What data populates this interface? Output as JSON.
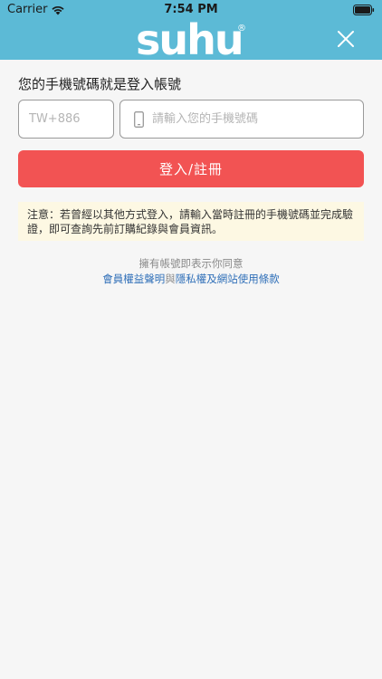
{
  "status_bar": {
    "carrier": "Carrier",
    "time": "7:54 PM"
  },
  "header": {
    "logo_text": "suhu",
    "logo_mark": "®",
    "brand_color": "#5cbad6"
  },
  "login": {
    "title": "您的手機號碼就是登入帳號",
    "country_placeholder": "TW+886",
    "phone_placeholder": "請輸入您的手機號碼",
    "submit_label": "登入/註冊",
    "submit_color": "#f25353"
  },
  "notice": {
    "text": "注意：若曾經以其他方式登入，請輸入當時註冊的手機號碼並完成驗證，即可查詢先前訂購紀錄與會員資訊。"
  },
  "agreement": {
    "prefix": "擁有帳號即表示你同意",
    "link_member": "會員權益聲明",
    "connector": "與",
    "link_privacy": "隱私權及網站使用條款"
  }
}
